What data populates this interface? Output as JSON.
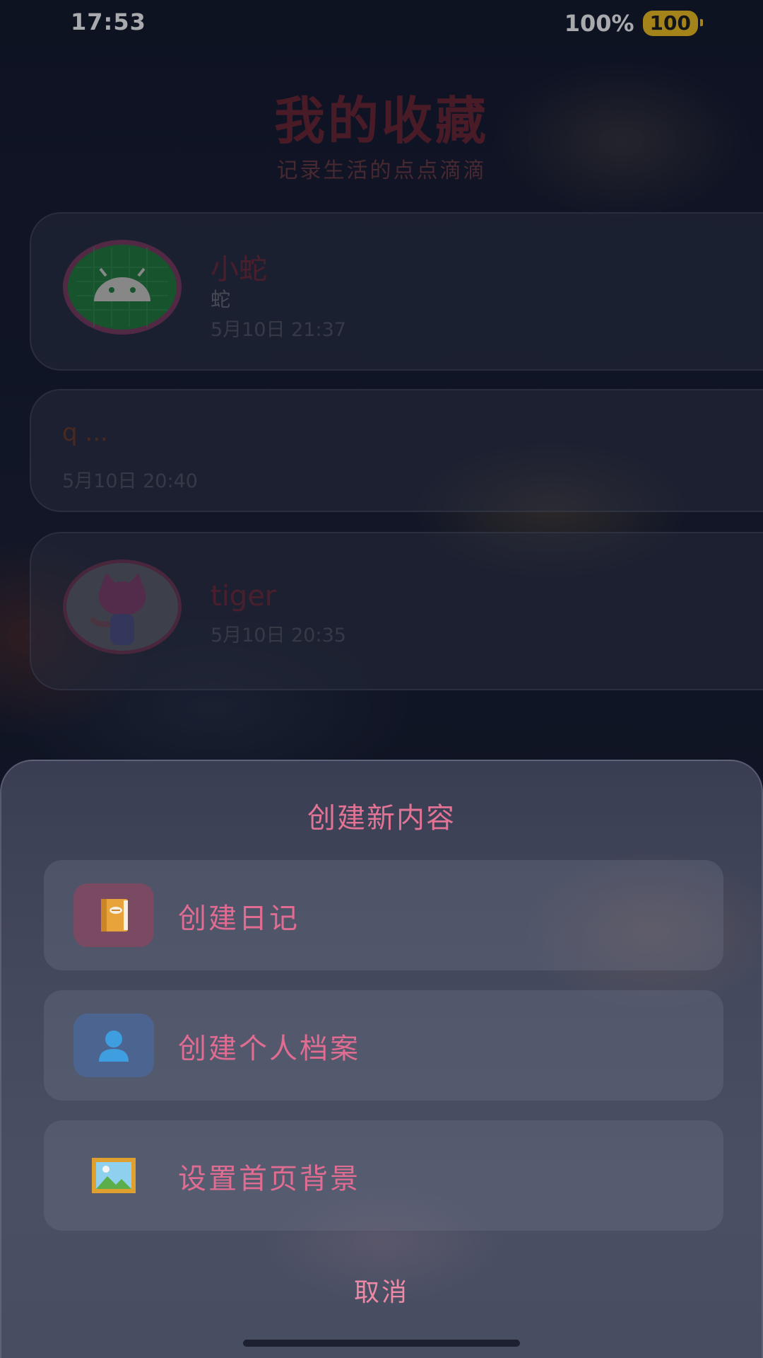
{
  "status_bar": {
    "time": "17:53",
    "battery_percent": "100%",
    "battery_badge": "100"
  },
  "header": {
    "title": "我的收藏",
    "subtitle": "记录生活的点点滴滴"
  },
  "cards": [
    {
      "title": "小蛇",
      "desc": "蛇",
      "date": "5月10日 21:37",
      "avatar_icon": "android-icon"
    },
    {
      "title": "q ...",
      "date": "5月10日 20:40"
    },
    {
      "title": "tiger",
      "date": "5月10日 20:35",
      "avatar_icon": "octocat-icon"
    }
  ],
  "sheet": {
    "title": "创建新内容",
    "options": [
      {
        "label": "创建日记",
        "icon": "notebook-icon"
      },
      {
        "label": "创建个人档案",
        "icon": "person-icon"
      },
      {
        "label": "设置首页背景",
        "icon": "framed-picture-icon"
      }
    ],
    "cancel_label": "取消"
  }
}
